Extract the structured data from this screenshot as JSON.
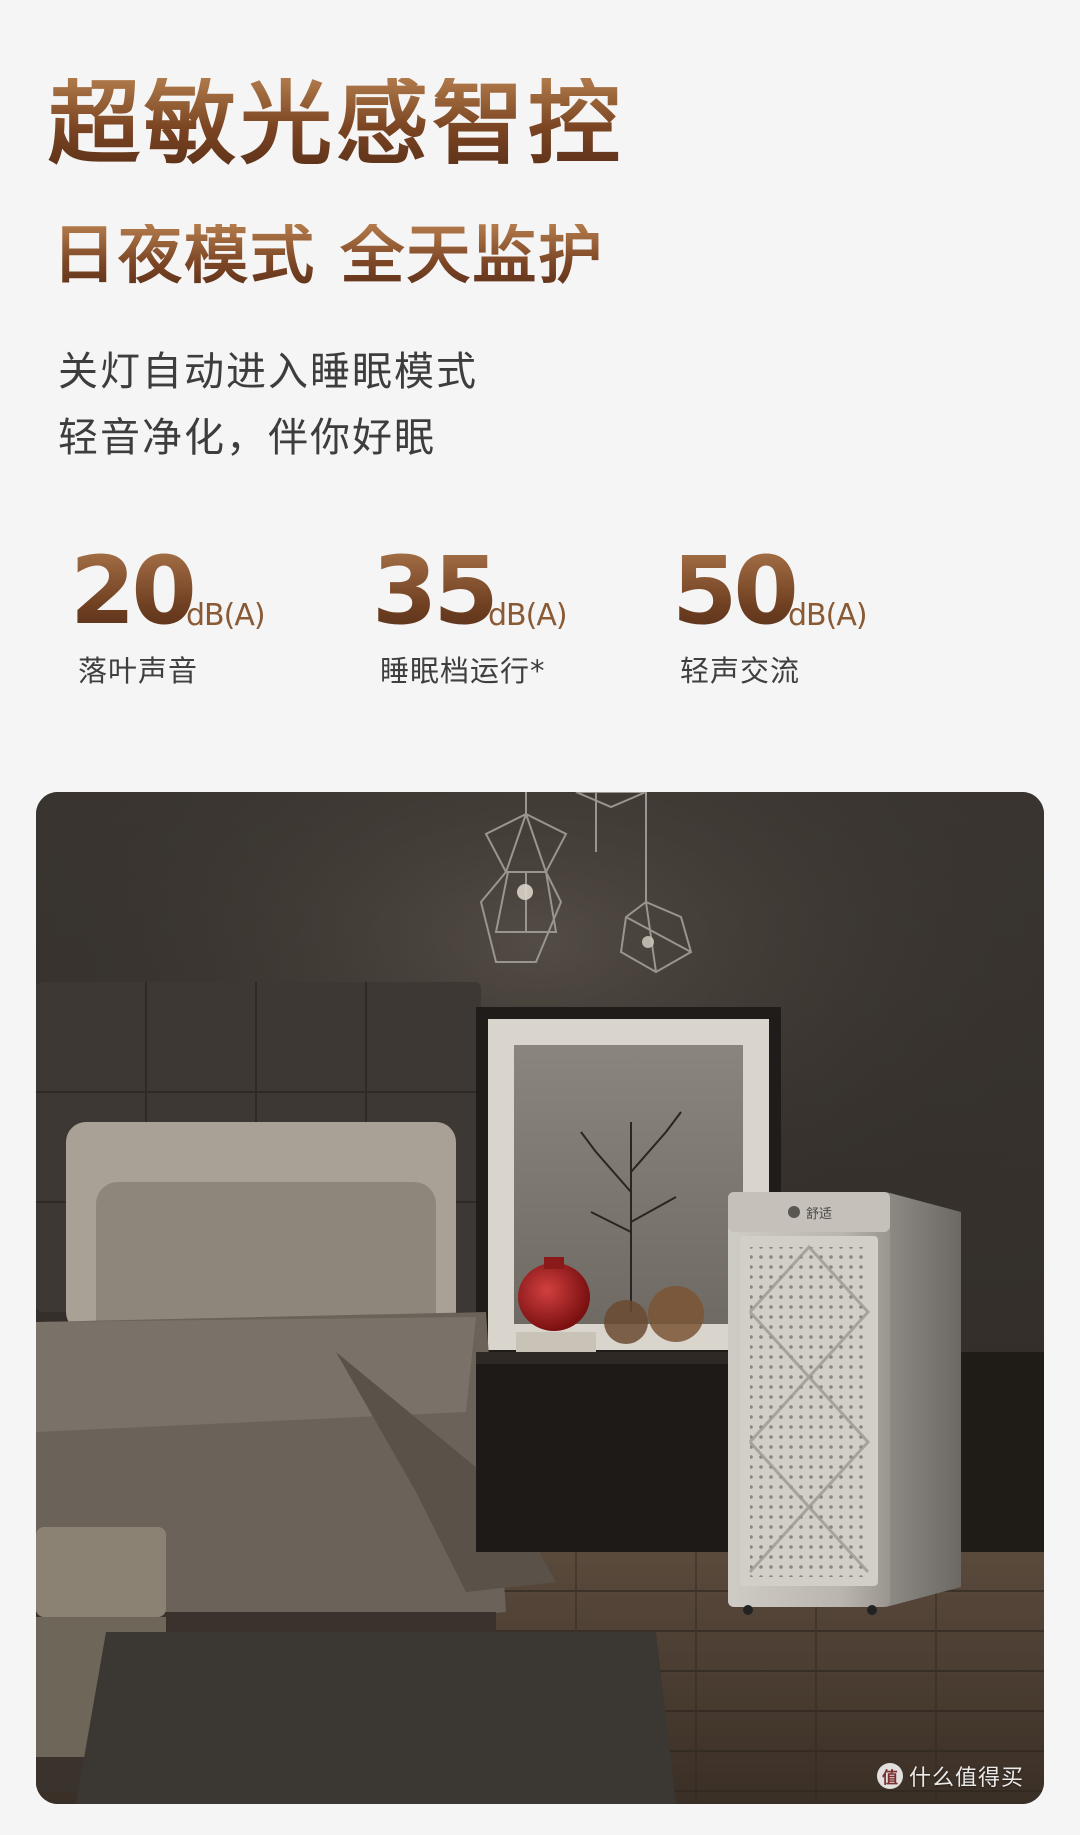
{
  "headline": "超敏光感智控",
  "subheadline": "日夜模式 全天监护",
  "description": {
    "line1": "关灯自动进入睡眠模式",
    "line2": "轻音净化，伴你好眠"
  },
  "stats": [
    {
      "value": "20",
      "unit": "dB(A)",
      "caption": "落叶声音"
    },
    {
      "value": "35",
      "unit": "dB(A)",
      "caption": "睡眠档运行*"
    },
    {
      "value": "50",
      "unit": "dB(A)",
      "caption": "轻声交流"
    }
  ],
  "scene": {
    "device_brand": "舒适"
  },
  "watermark": {
    "logo": "值",
    "text": "什么值得买"
  }
}
